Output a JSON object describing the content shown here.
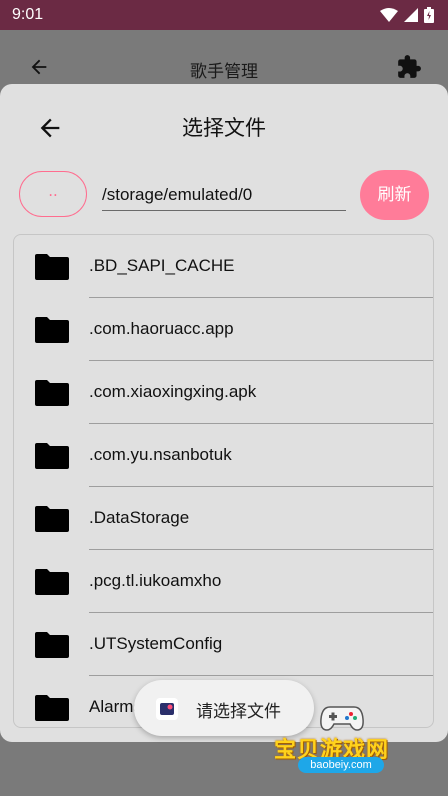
{
  "status_bar": {
    "time": "9:01"
  },
  "background_app": {
    "title": "歌手管理"
  },
  "dialog": {
    "title": "选择文件",
    "up_label": "..",
    "path_value": "/storage/emulated/0",
    "refresh_label": "刷新",
    "files": [
      ".BD_SAPI_CACHE",
      ".com.haoruacc.app",
      ".com.xiaoxingxing.apk",
      ".com.yu.nsanbotuk",
      ".DataStorage",
      ".pcg.tl.iukoamxho",
      ".UTSystemConfig",
      "Alarms"
    ]
  },
  "toast": {
    "text": "请选择文件"
  },
  "watermark": {
    "title": "宝贝游戏网",
    "url": "baobeiy.com"
  },
  "colors": {
    "status_bar": "#6b2a44",
    "accent": "#ff7c99",
    "sheet": "#e0e0e0"
  }
}
